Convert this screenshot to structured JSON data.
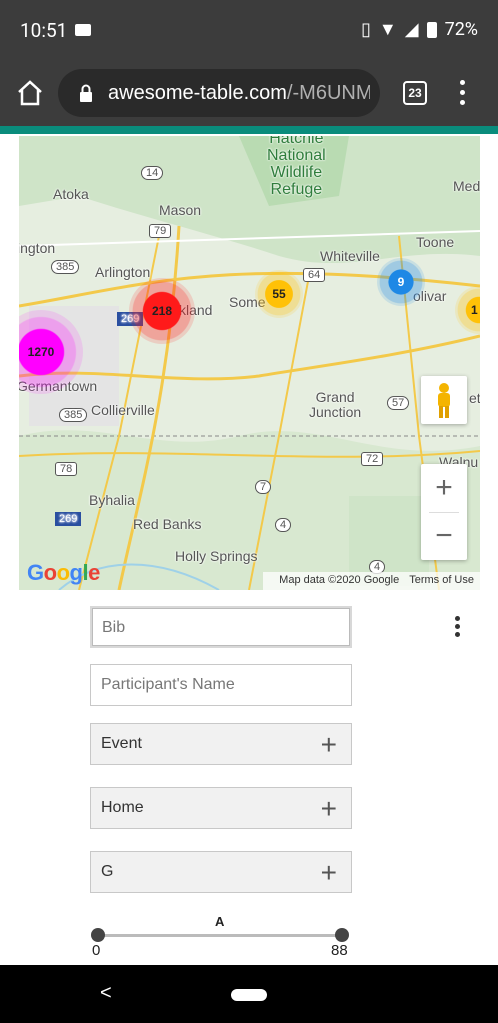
{
  "status": {
    "time": "10:51",
    "battery": "72%"
  },
  "browser": {
    "url_main": "awesome-table.com",
    "url_rest": "/-M6UNM",
    "tab_count": "23"
  },
  "map": {
    "labels": {
      "hatchie": "Hatchie\nNational\nWildlife\nRefuge",
      "atoka": "Atoka",
      "mason": "Mason",
      "med": "Med",
      "toone": "Toone",
      "ington": "ington",
      "arlington": "Arlington",
      "whiteville": "Whiteville",
      "kland": "kland",
      "some": "Some",
      "olivar": "olivar",
      "germantown": "Germantown",
      "collierville": "Collierville",
      "grand_junction": "Grand\nJunction",
      "et": "et",
      "walnu": "Walnu",
      "byhalia": "Byhalia",
      "red_banks": "Red Banks",
      "holly_springs": "Holly Springs"
    },
    "shields": [
      "14",
      "79",
      "385",
      "64",
      "269",
      "57",
      "72",
      "78",
      "7",
      "4",
      "4",
      "385"
    ],
    "clusters": [
      {
        "count": "1270",
        "color": "#ff00ff"
      },
      {
        "count": "218",
        "color": "#ff1a1a"
      },
      {
        "count": "55",
        "color": "#ffc107"
      },
      {
        "count": "9",
        "color": "#1e88e5"
      },
      {
        "count": "1",
        "color": "#ffc107"
      }
    ],
    "google": "Google",
    "map_data": "Map data ©2020 Google",
    "terms": "Terms of Use",
    "zoom_in": "+",
    "zoom_out": "−"
  },
  "form": {
    "bib_placeholder": "Bib",
    "name_placeholder": "Participant's Name",
    "event_label": "Event",
    "home_label": "Home",
    "g_label": "G",
    "plus": "+"
  },
  "slider": {
    "label": "A",
    "min": "0",
    "max": "88",
    "value_low": 0,
    "value_high": 88
  }
}
